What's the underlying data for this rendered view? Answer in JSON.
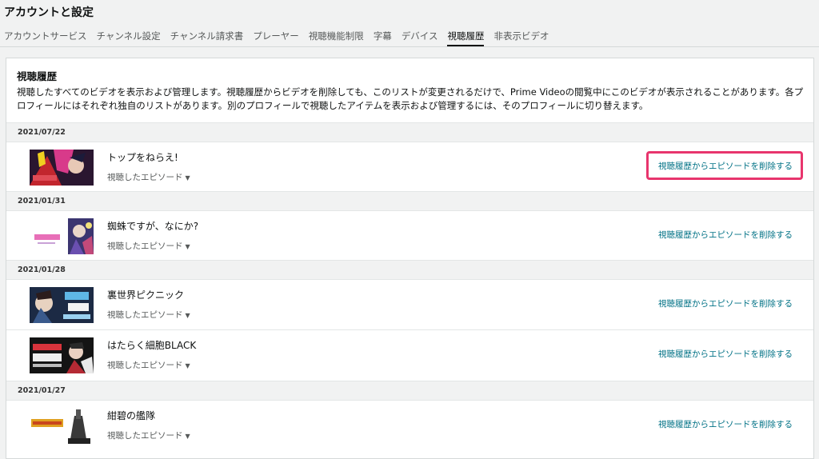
{
  "page": {
    "title": "アカウントと設定"
  },
  "tabs": [
    {
      "label": "アカウントサービス"
    },
    {
      "label": "チャンネル設定"
    },
    {
      "label": "チャンネル請求書"
    },
    {
      "label": "プレーヤー"
    },
    {
      "label": "視聴機能制限"
    },
    {
      "label": "字幕"
    },
    {
      "label": "デバイス"
    },
    {
      "label": "視聴履歴"
    },
    {
      "label": "非表示ビデオ"
    }
  ],
  "active_tab": "視聴履歴",
  "section": {
    "title": "視聴履歴",
    "description": "視聴したすべてのビデオを表示および管理します。視聴履歴からビデオを削除しても、このリストが変更されるだけで、Prime Videoの閲覧中にこのビデオが表示されることがあります。各プロフィールにはそれぞれ独自のリストがあります。別のプロフィールで視聴したアイテムを表示および管理するには、そのプロフィールに切り替えます。"
  },
  "history": {
    "groups": [
      {
        "date": "2021/07/22",
        "items": [
          {
            "title": "トップをねらえ!",
            "dropdown": "視聴したエピソード",
            "remove": "視聴履歴からエピソードを削除する"
          }
        ]
      },
      {
        "date": "2021/01/31",
        "items": [
          {
            "title": "蜘蛛ですが、なにか?",
            "dropdown": "視聴したエピソード",
            "remove": "視聴履歴からエピソードを削除する"
          }
        ]
      },
      {
        "date": "2021/01/28",
        "items": [
          {
            "title": "裏世界ピクニック",
            "dropdown": "視聴したエピソード",
            "remove": "視聴履歴からエピソードを削除する"
          },
          {
            "title": "はたらく細胞BLACK",
            "dropdown": "視聴したエピソード",
            "remove": "視聴履歴からエピソードを削除する"
          }
        ]
      },
      {
        "date": "2021/01/27",
        "items": [
          {
            "title": "紺碧の艦隊",
            "dropdown": "視聴したエピソード",
            "remove": "視聴履歴からエピソードを削除する"
          }
        ]
      }
    ]
  },
  "colors": {
    "link": "#007185",
    "highlight": "#e8356d",
    "date_bar": "#f1f2f2"
  }
}
